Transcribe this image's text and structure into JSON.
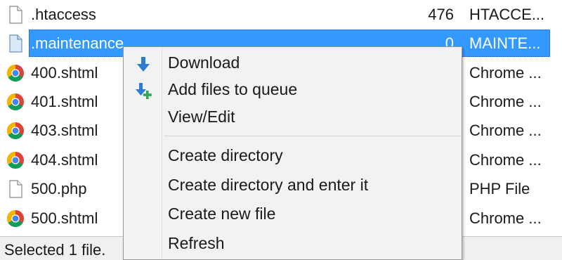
{
  "files": [
    {
      "icon": "document-icon",
      "name": ".htaccess",
      "size": "476",
      "type": "HTACCE..."
    },
    {
      "icon": "document-icon",
      "name": ".maintenance",
      "size": "0",
      "type": "MAINTE...",
      "selected": true
    },
    {
      "icon": "chrome-icon",
      "name": "400.shtml",
      "size": "",
      "type": "Chrome ..."
    },
    {
      "icon": "chrome-icon",
      "name": "401.shtml",
      "size": "",
      "type": "Chrome ..."
    },
    {
      "icon": "chrome-icon",
      "name": "403.shtml",
      "size": "",
      "type": "Chrome ..."
    },
    {
      "icon": "chrome-icon",
      "name": "404.shtml",
      "size": "",
      "type": "Chrome ..."
    },
    {
      "icon": "document-icon",
      "name": "500.php",
      "size": "",
      "type": "PHP File"
    },
    {
      "icon": "chrome-icon",
      "name": "500.shtml",
      "size": "",
      "type": "Chrome ..."
    }
  ],
  "status": {
    "text": "Selected 1 file."
  },
  "context_menu": {
    "items": [
      {
        "label": "Download",
        "icon": "download-arrow-icon"
      },
      {
        "label": "Add files to queue",
        "icon": "add-to-queue-icon"
      },
      {
        "label": "View/Edit",
        "icon": ""
      },
      {
        "label": "Create directory",
        "icon": ""
      },
      {
        "label": "Create directory and enter it",
        "icon": ""
      },
      {
        "label": "Create new file",
        "icon": ""
      },
      {
        "label": "Refresh",
        "icon": ""
      }
    ]
  },
  "colors": {
    "selection": "#3399ff",
    "arrow_blue": "#2a7fd4",
    "plus_green": "#2fa84f",
    "menu_bg": "#f2f2f2"
  }
}
